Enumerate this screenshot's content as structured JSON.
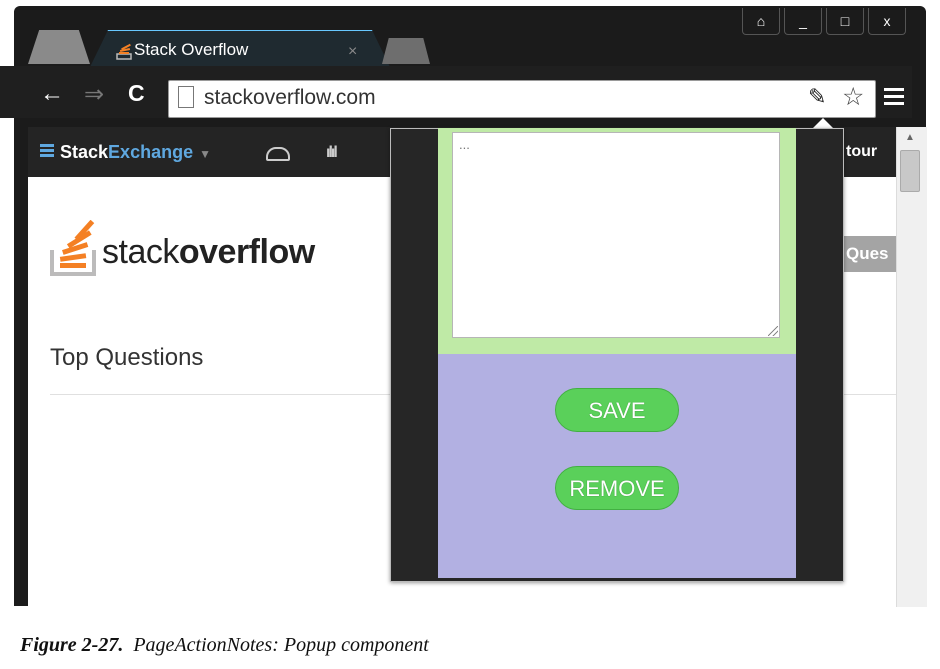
{
  "window": {
    "controls": [
      "⌂",
      "_",
      "□",
      "x"
    ]
  },
  "tab": {
    "title": "Stack Overflow",
    "close": "×"
  },
  "toolbar": {
    "back": "←",
    "forward": "⇒",
    "reload": "C",
    "url": "stackoverflow.com"
  },
  "stackexchange_bar": {
    "stack": "Stack",
    "exchange": "Exchange",
    "tour": "tour"
  },
  "page": {
    "logo_light": "stack",
    "logo_bold": "overflow",
    "questions_button": "Ques",
    "heading": "Top Questions"
  },
  "popup": {
    "note_placeholder": "...",
    "save_label": "SAVE",
    "remove_label": "REMOVE"
  },
  "caption": {
    "figure": "Figure 2-27.",
    "text": "PageActionNotes: Popup component"
  }
}
